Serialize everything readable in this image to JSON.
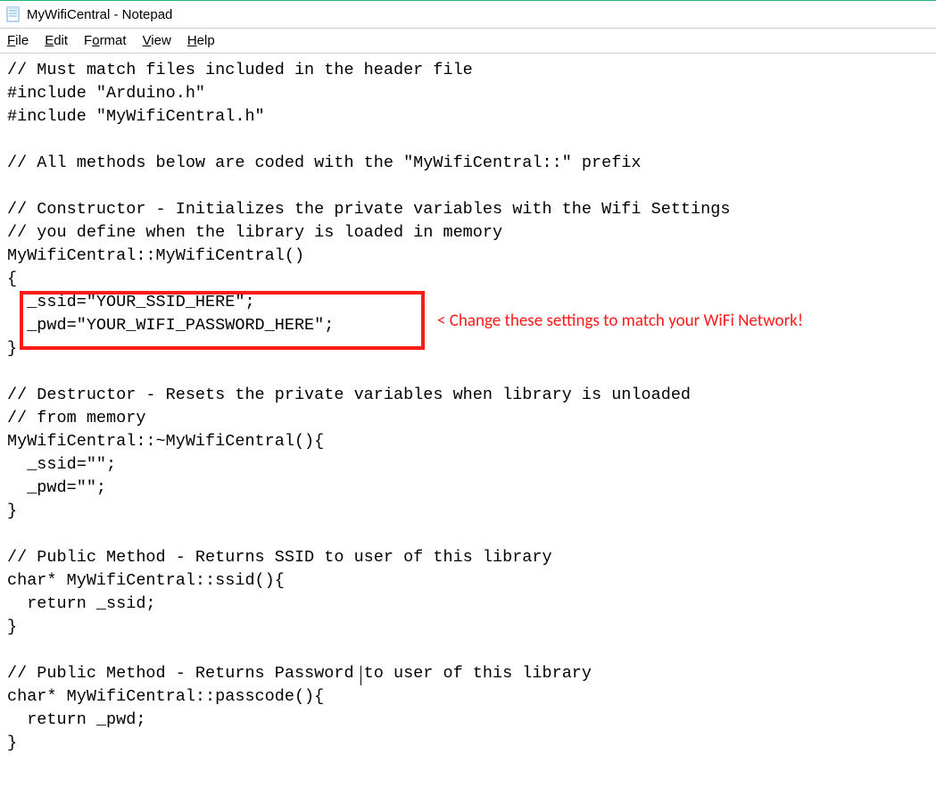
{
  "window": {
    "title": "MyWifiCentral - Notepad"
  },
  "menu": {
    "file": {
      "label": "File",
      "accel": "F"
    },
    "edit": {
      "label": "Edit",
      "accel": "E"
    },
    "format": {
      "label": "Format",
      "accel": "o"
    },
    "view": {
      "label": "View",
      "accel": "V"
    },
    "help": {
      "label": "Help",
      "accel": "H"
    }
  },
  "code": {
    "l01": "// Must match files included in the header file",
    "l02": "#include \"Arduino.h\"",
    "l03": "#include \"MyWifiCentral.h\"",
    "l04": "",
    "l05": "// All methods below are coded with the \"MyWifiCentral::\" prefix",
    "l06": "",
    "l07": "// Constructor - Initializes the private variables with the Wifi Settings",
    "l08": "// you define when the library is loaded in memory",
    "l09": "MyWifiCentral::MyWifiCentral()",
    "l10": "{",
    "l11": "  _ssid=\"YOUR_SSID_HERE\";",
    "l12": "  _pwd=\"YOUR_WIFI_PASSWORD_HERE\";",
    "l13": "}",
    "l14": "",
    "l15": "// Destructor - Resets the private variables when library is unloaded",
    "l16": "// from memory",
    "l17": "MyWifiCentral::~MyWifiCentral(){",
    "l18": "  _ssid=\"\";",
    "l19": "  _pwd=\"\";",
    "l20": "}",
    "l21": "",
    "l22": "// Public Method - Returns SSID to user of this library",
    "l23": "char* MyWifiCentral::ssid(){",
    "l24": "  return _ssid;",
    "l25": "}",
    "l26": "",
    "l27": "// Public Method - Returns Password to user of this library",
    "l28": "char* MyWifiCentral::passcode(){",
    "l29": "  return _pwd;",
    "l30": "}"
  },
  "annotation": {
    "text": "< Change these settings to match your WiFi Network!"
  }
}
